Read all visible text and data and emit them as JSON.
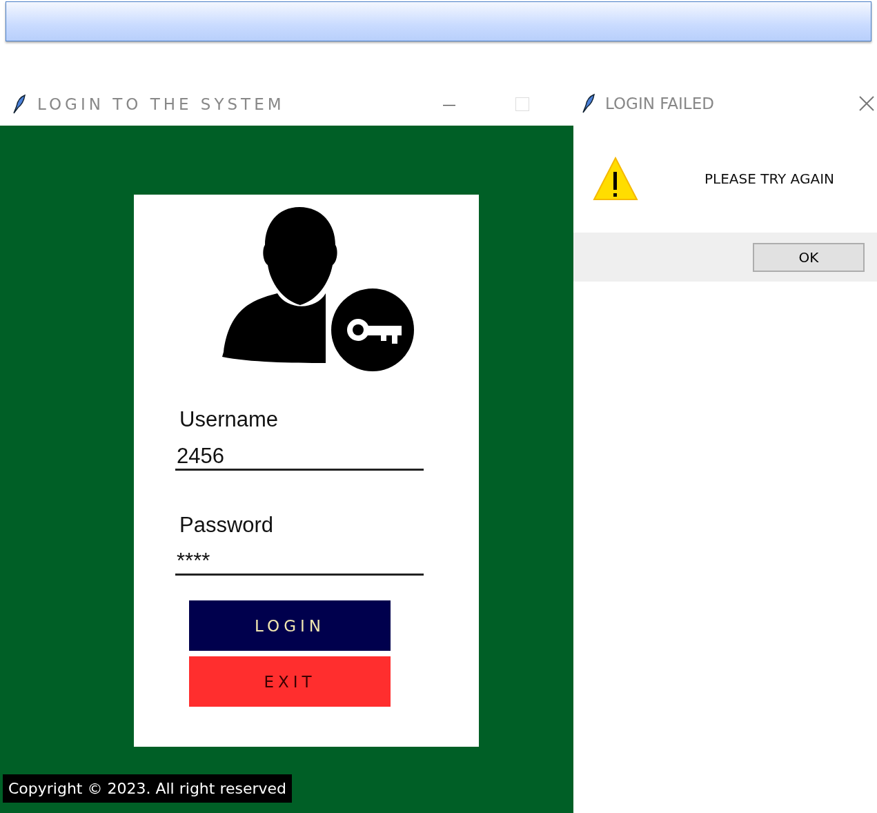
{
  "main_window": {
    "title": "LOGIN TO THE SYSTEM",
    "title_buttons": [
      "—"
    ]
  },
  "login_form": {
    "fields": [
      {
        "label": "Username",
        "value": "2456"
      },
      {
        "label": "Password",
        "value": "****"
      }
    ],
    "buttons": [
      {
        "label": "LOGIN",
        "kind": "primary"
      },
      {
        "label": "EXIT",
        "kind": "danger"
      }
    ]
  },
  "footer": {
    "text": "Copyright © 2023. All right reserved"
  },
  "dialog": {
    "title": "LOGIN FAILED",
    "message": "PLEASE TRY AGAIN",
    "button": "OK"
  }
}
